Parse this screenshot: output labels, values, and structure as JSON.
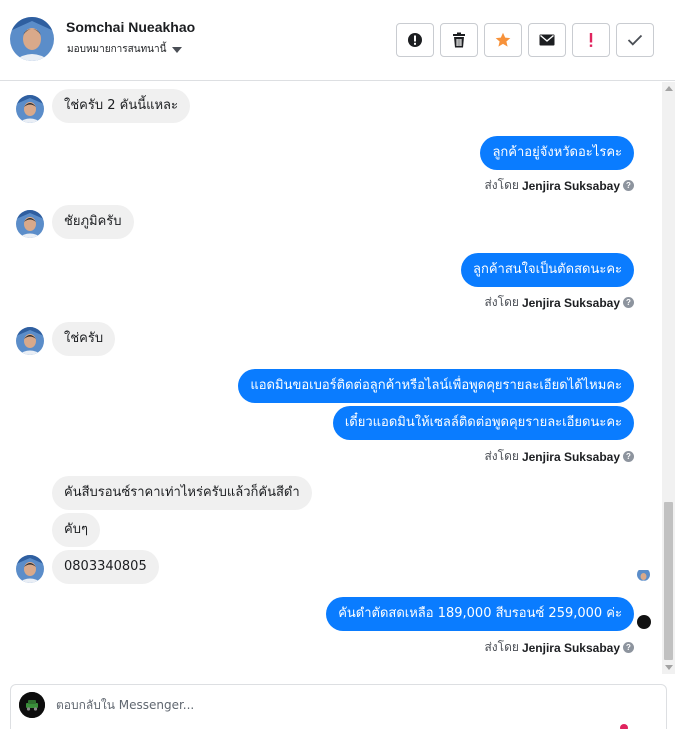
{
  "header": {
    "contact_name": "Somchai Nueakhao",
    "assign_label": "มอบหมายการสนทนานี้",
    "actions": [
      {
        "name": "spam-button",
        "icon": "alert-circle-icon"
      },
      {
        "name": "delete-button",
        "icon": "trash-icon"
      },
      {
        "name": "star-button",
        "icon": "star-icon"
      },
      {
        "name": "mark-unread-button",
        "icon": "envelope-icon"
      },
      {
        "name": "follow-up-button",
        "icon": "exclamation-icon"
      },
      {
        "name": "mark-done-button",
        "icon": "checkmark-icon"
      }
    ]
  },
  "thread": {
    "messages": [
      {
        "dir": "in",
        "text": "ใช่ครับ 2 คันนี้แหละ"
      },
      {
        "dir": "out",
        "text": "ลูกค้าอยู่จังหวัดอะไรคะ"
      },
      {
        "dir": "in",
        "text": "ชัยภูมิครับ"
      },
      {
        "dir": "out",
        "text": "ลูกค้าสนใจเป็นตัดสดนะคะ"
      },
      {
        "dir": "in",
        "text": "ใช่ครับ"
      },
      {
        "dir": "out",
        "text": "แอดมินขอเบอร์ติดต่อลูกค้าหรือไลน์เพื่อพูดคุยรายละเอียดได้ไหมคะ"
      },
      {
        "dir": "out",
        "text": "เดี๋ยวแอดมินให้เซลล์ติดต่อพูดคุยรายละเอียดนะคะ"
      },
      {
        "dir": "in",
        "text": "คันสีบรอนซ์ราคาเท่าไหร่ครับแล้วก็คันสีดำ"
      },
      {
        "dir": "in",
        "text": "คับๆ"
      },
      {
        "dir": "in",
        "text": "0803340805"
      },
      {
        "dir": "out",
        "text": "คันดำตัดสดเหลือ 189,000 สีบรอนซ์ 259,000 ค่ะ"
      }
    ],
    "sent_by_prefix": "ส่งโดย",
    "sent_by_name": "Jenjira Suksabay",
    "help_glyph": "?"
  },
  "composer": {
    "placeholder": "ตอบกลับใน Messenger..."
  },
  "colors": {
    "outgoing": "#0a7cff",
    "incoming": "#f0f0f0",
    "star": "#f7923a",
    "alert": "#e0245e"
  }
}
